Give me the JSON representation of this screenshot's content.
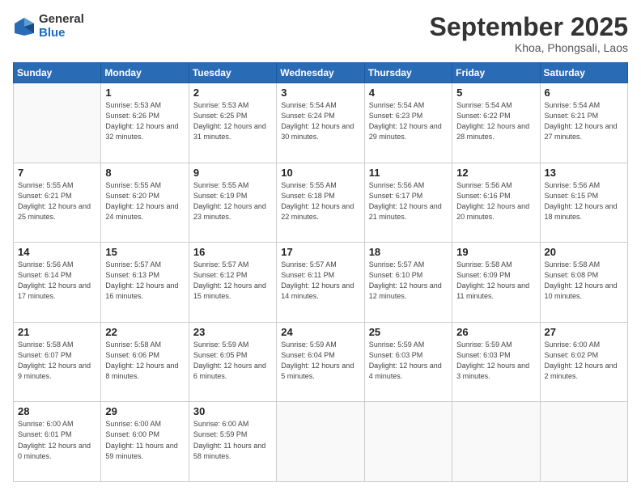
{
  "logo": {
    "general": "General",
    "blue": "Blue"
  },
  "header": {
    "month": "September 2025",
    "location": "Khoa, Phongsali, Laos"
  },
  "days_of_week": [
    "Sunday",
    "Monday",
    "Tuesday",
    "Wednesday",
    "Thursday",
    "Friday",
    "Saturday"
  ],
  "weeks": [
    [
      {
        "day": "",
        "info": ""
      },
      {
        "day": "1",
        "info": "Sunrise: 5:53 AM\nSunset: 6:26 PM\nDaylight: 12 hours\nand 32 minutes."
      },
      {
        "day": "2",
        "info": "Sunrise: 5:53 AM\nSunset: 6:25 PM\nDaylight: 12 hours\nand 31 minutes."
      },
      {
        "day": "3",
        "info": "Sunrise: 5:54 AM\nSunset: 6:24 PM\nDaylight: 12 hours\nand 30 minutes."
      },
      {
        "day": "4",
        "info": "Sunrise: 5:54 AM\nSunset: 6:23 PM\nDaylight: 12 hours\nand 29 minutes."
      },
      {
        "day": "5",
        "info": "Sunrise: 5:54 AM\nSunset: 6:22 PM\nDaylight: 12 hours\nand 28 minutes."
      },
      {
        "day": "6",
        "info": "Sunrise: 5:54 AM\nSunset: 6:21 PM\nDaylight: 12 hours\nand 27 minutes."
      }
    ],
    [
      {
        "day": "7",
        "info": "Sunrise: 5:55 AM\nSunset: 6:21 PM\nDaylight: 12 hours\nand 25 minutes."
      },
      {
        "day": "8",
        "info": "Sunrise: 5:55 AM\nSunset: 6:20 PM\nDaylight: 12 hours\nand 24 minutes."
      },
      {
        "day": "9",
        "info": "Sunrise: 5:55 AM\nSunset: 6:19 PM\nDaylight: 12 hours\nand 23 minutes."
      },
      {
        "day": "10",
        "info": "Sunrise: 5:55 AM\nSunset: 6:18 PM\nDaylight: 12 hours\nand 22 minutes."
      },
      {
        "day": "11",
        "info": "Sunrise: 5:56 AM\nSunset: 6:17 PM\nDaylight: 12 hours\nand 21 minutes."
      },
      {
        "day": "12",
        "info": "Sunrise: 5:56 AM\nSunset: 6:16 PM\nDaylight: 12 hours\nand 20 minutes."
      },
      {
        "day": "13",
        "info": "Sunrise: 5:56 AM\nSunset: 6:15 PM\nDaylight: 12 hours\nand 18 minutes."
      }
    ],
    [
      {
        "day": "14",
        "info": "Sunrise: 5:56 AM\nSunset: 6:14 PM\nDaylight: 12 hours\nand 17 minutes."
      },
      {
        "day": "15",
        "info": "Sunrise: 5:57 AM\nSunset: 6:13 PM\nDaylight: 12 hours\nand 16 minutes."
      },
      {
        "day": "16",
        "info": "Sunrise: 5:57 AM\nSunset: 6:12 PM\nDaylight: 12 hours\nand 15 minutes."
      },
      {
        "day": "17",
        "info": "Sunrise: 5:57 AM\nSunset: 6:11 PM\nDaylight: 12 hours\nand 14 minutes."
      },
      {
        "day": "18",
        "info": "Sunrise: 5:57 AM\nSunset: 6:10 PM\nDaylight: 12 hours\nand 12 minutes."
      },
      {
        "day": "19",
        "info": "Sunrise: 5:58 AM\nSunset: 6:09 PM\nDaylight: 12 hours\nand 11 minutes."
      },
      {
        "day": "20",
        "info": "Sunrise: 5:58 AM\nSunset: 6:08 PM\nDaylight: 12 hours\nand 10 minutes."
      }
    ],
    [
      {
        "day": "21",
        "info": "Sunrise: 5:58 AM\nSunset: 6:07 PM\nDaylight: 12 hours\nand 9 minutes."
      },
      {
        "day": "22",
        "info": "Sunrise: 5:58 AM\nSunset: 6:06 PM\nDaylight: 12 hours\nand 8 minutes."
      },
      {
        "day": "23",
        "info": "Sunrise: 5:59 AM\nSunset: 6:05 PM\nDaylight: 12 hours\nand 6 minutes."
      },
      {
        "day": "24",
        "info": "Sunrise: 5:59 AM\nSunset: 6:04 PM\nDaylight: 12 hours\nand 5 minutes."
      },
      {
        "day": "25",
        "info": "Sunrise: 5:59 AM\nSunset: 6:03 PM\nDaylight: 12 hours\nand 4 minutes."
      },
      {
        "day": "26",
        "info": "Sunrise: 5:59 AM\nSunset: 6:03 PM\nDaylight: 12 hours\nand 3 minutes."
      },
      {
        "day": "27",
        "info": "Sunrise: 6:00 AM\nSunset: 6:02 PM\nDaylight: 12 hours\nand 2 minutes."
      }
    ],
    [
      {
        "day": "28",
        "info": "Sunrise: 6:00 AM\nSunset: 6:01 PM\nDaylight: 12 hours\nand 0 minutes."
      },
      {
        "day": "29",
        "info": "Sunrise: 6:00 AM\nSunset: 6:00 PM\nDaylight: 11 hours\nand 59 minutes."
      },
      {
        "day": "30",
        "info": "Sunrise: 6:00 AM\nSunset: 5:59 PM\nDaylight: 11 hours\nand 58 minutes."
      },
      {
        "day": "",
        "info": ""
      },
      {
        "day": "",
        "info": ""
      },
      {
        "day": "",
        "info": ""
      },
      {
        "day": "",
        "info": ""
      }
    ]
  ]
}
